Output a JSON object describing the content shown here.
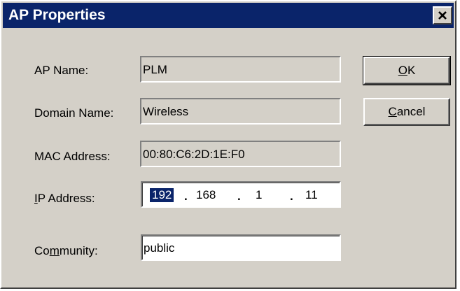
{
  "window": {
    "title": "AP Properties",
    "close_glyph": "✕"
  },
  "fields": {
    "ap_name": {
      "label_pre": "AP Name:",
      "value": "PLM"
    },
    "domain_name": {
      "label_pre": "Domain Name:",
      "value": "Wireless"
    },
    "mac_address": {
      "label_pre": "MAC Address:",
      "value": "00:80:C6:2D:1E:F0"
    },
    "ip_address": {
      "label_accel": "I",
      "label_rest": "P Address:",
      "octets": [
        "192",
        "168",
        "1",
        "11"
      ],
      "selected_octet": 0
    },
    "community": {
      "label_pre": "Co",
      "label_accel": "m",
      "label_rest": "munity:",
      "value": "public"
    }
  },
  "buttons": {
    "ok": {
      "accel": "O",
      "rest": "K"
    },
    "cancel": {
      "accel": "C",
      "rest": "ancel"
    }
  }
}
